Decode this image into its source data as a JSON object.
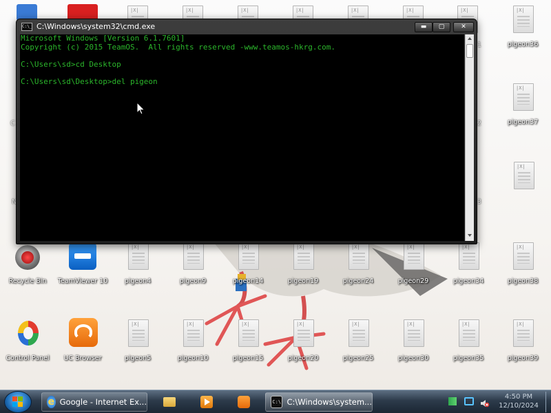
{
  "cmd_window": {
    "title": "C:\\Windows\\system32\\cmd.exe",
    "app_icon_text": "C:\\_",
    "minimize_symbol": "▬",
    "maximize_symbol": "▢",
    "close_symbol": "✕",
    "lines": [
      "Microsoft Windows [Version 6.1.7601]",
      "Copyright (c) 2015 TeamOS.  All rights reserved -www.teamos-hkrg.com.",
      "",
      "C:\\Users\\sd>cd Desktop",
      "",
      "C:\\Users\\sd\\Desktop>del pigeon"
    ],
    "text_color": "#2bb52b"
  },
  "desktop_icons": [
    {
      "label": "pigeon36",
      "kind": "txt"
    },
    {
      "label": "pigeon37",
      "kind": "txt"
    },
    {
      "label": "Recycle Bin",
      "kind": "recycle-bin"
    },
    {
      "label": "TeamViewer 10",
      "kind": "teamviewer"
    },
    {
      "label": "pigeon4",
      "kind": "txt"
    },
    {
      "label": "pigeon9",
      "kind": "txt"
    },
    {
      "label": "pigeon14",
      "kind": "txt"
    },
    {
      "label": "pigeon19",
      "kind": "txt"
    },
    {
      "label": "pigeon24",
      "kind": "txt"
    },
    {
      "label": "pigeon29",
      "kind": "txt"
    },
    {
      "label": "pigeon34",
      "kind": "txt"
    },
    {
      "label": "pigeon38",
      "kind": "txt"
    },
    {
      "label": "Control Panel",
      "kind": "control-panel"
    },
    {
      "label": "UC Browser",
      "kind": "uc-browser"
    },
    {
      "label": "pigeon5",
      "kind": "txt"
    },
    {
      "label": "pigeon10",
      "kind": "txt"
    },
    {
      "label": "pigeon15",
      "kind": "txt"
    },
    {
      "label": "pigeon20",
      "kind": "txt"
    },
    {
      "label": "pigeon25",
      "kind": "txt"
    },
    {
      "label": "pigeon30",
      "kind": "txt"
    },
    {
      "label": "pigeon35",
      "kind": "txt"
    },
    {
      "label": "pigeon39",
      "kind": "txt"
    }
  ],
  "partial_labels": {
    "left_c": "C",
    "left_n": "N",
    "right_1": "1",
    "right_2": "2",
    "right_3": "3"
  },
  "taskbar": {
    "items": [
      {
        "label": "Google - Internet Ex...",
        "icon": "ie-icon"
      },
      {
        "label": "C:\\Windows\\system...",
        "icon": "cmd-icon",
        "active": true
      }
    ],
    "pinned": [
      "explorer-icon",
      "media-player-icon",
      "uc-browser-icon"
    ],
    "clock_time": "4:50 PM",
    "clock_date": "12/10/2024",
    "tray": [
      "flag-icon",
      "network-icon",
      "volume-muted-icon"
    ]
  },
  "colors": {
    "console_green": "#2bb52b",
    "taskbar": "#2d3b4b",
    "accent_blue": "#1c6bb5"
  }
}
